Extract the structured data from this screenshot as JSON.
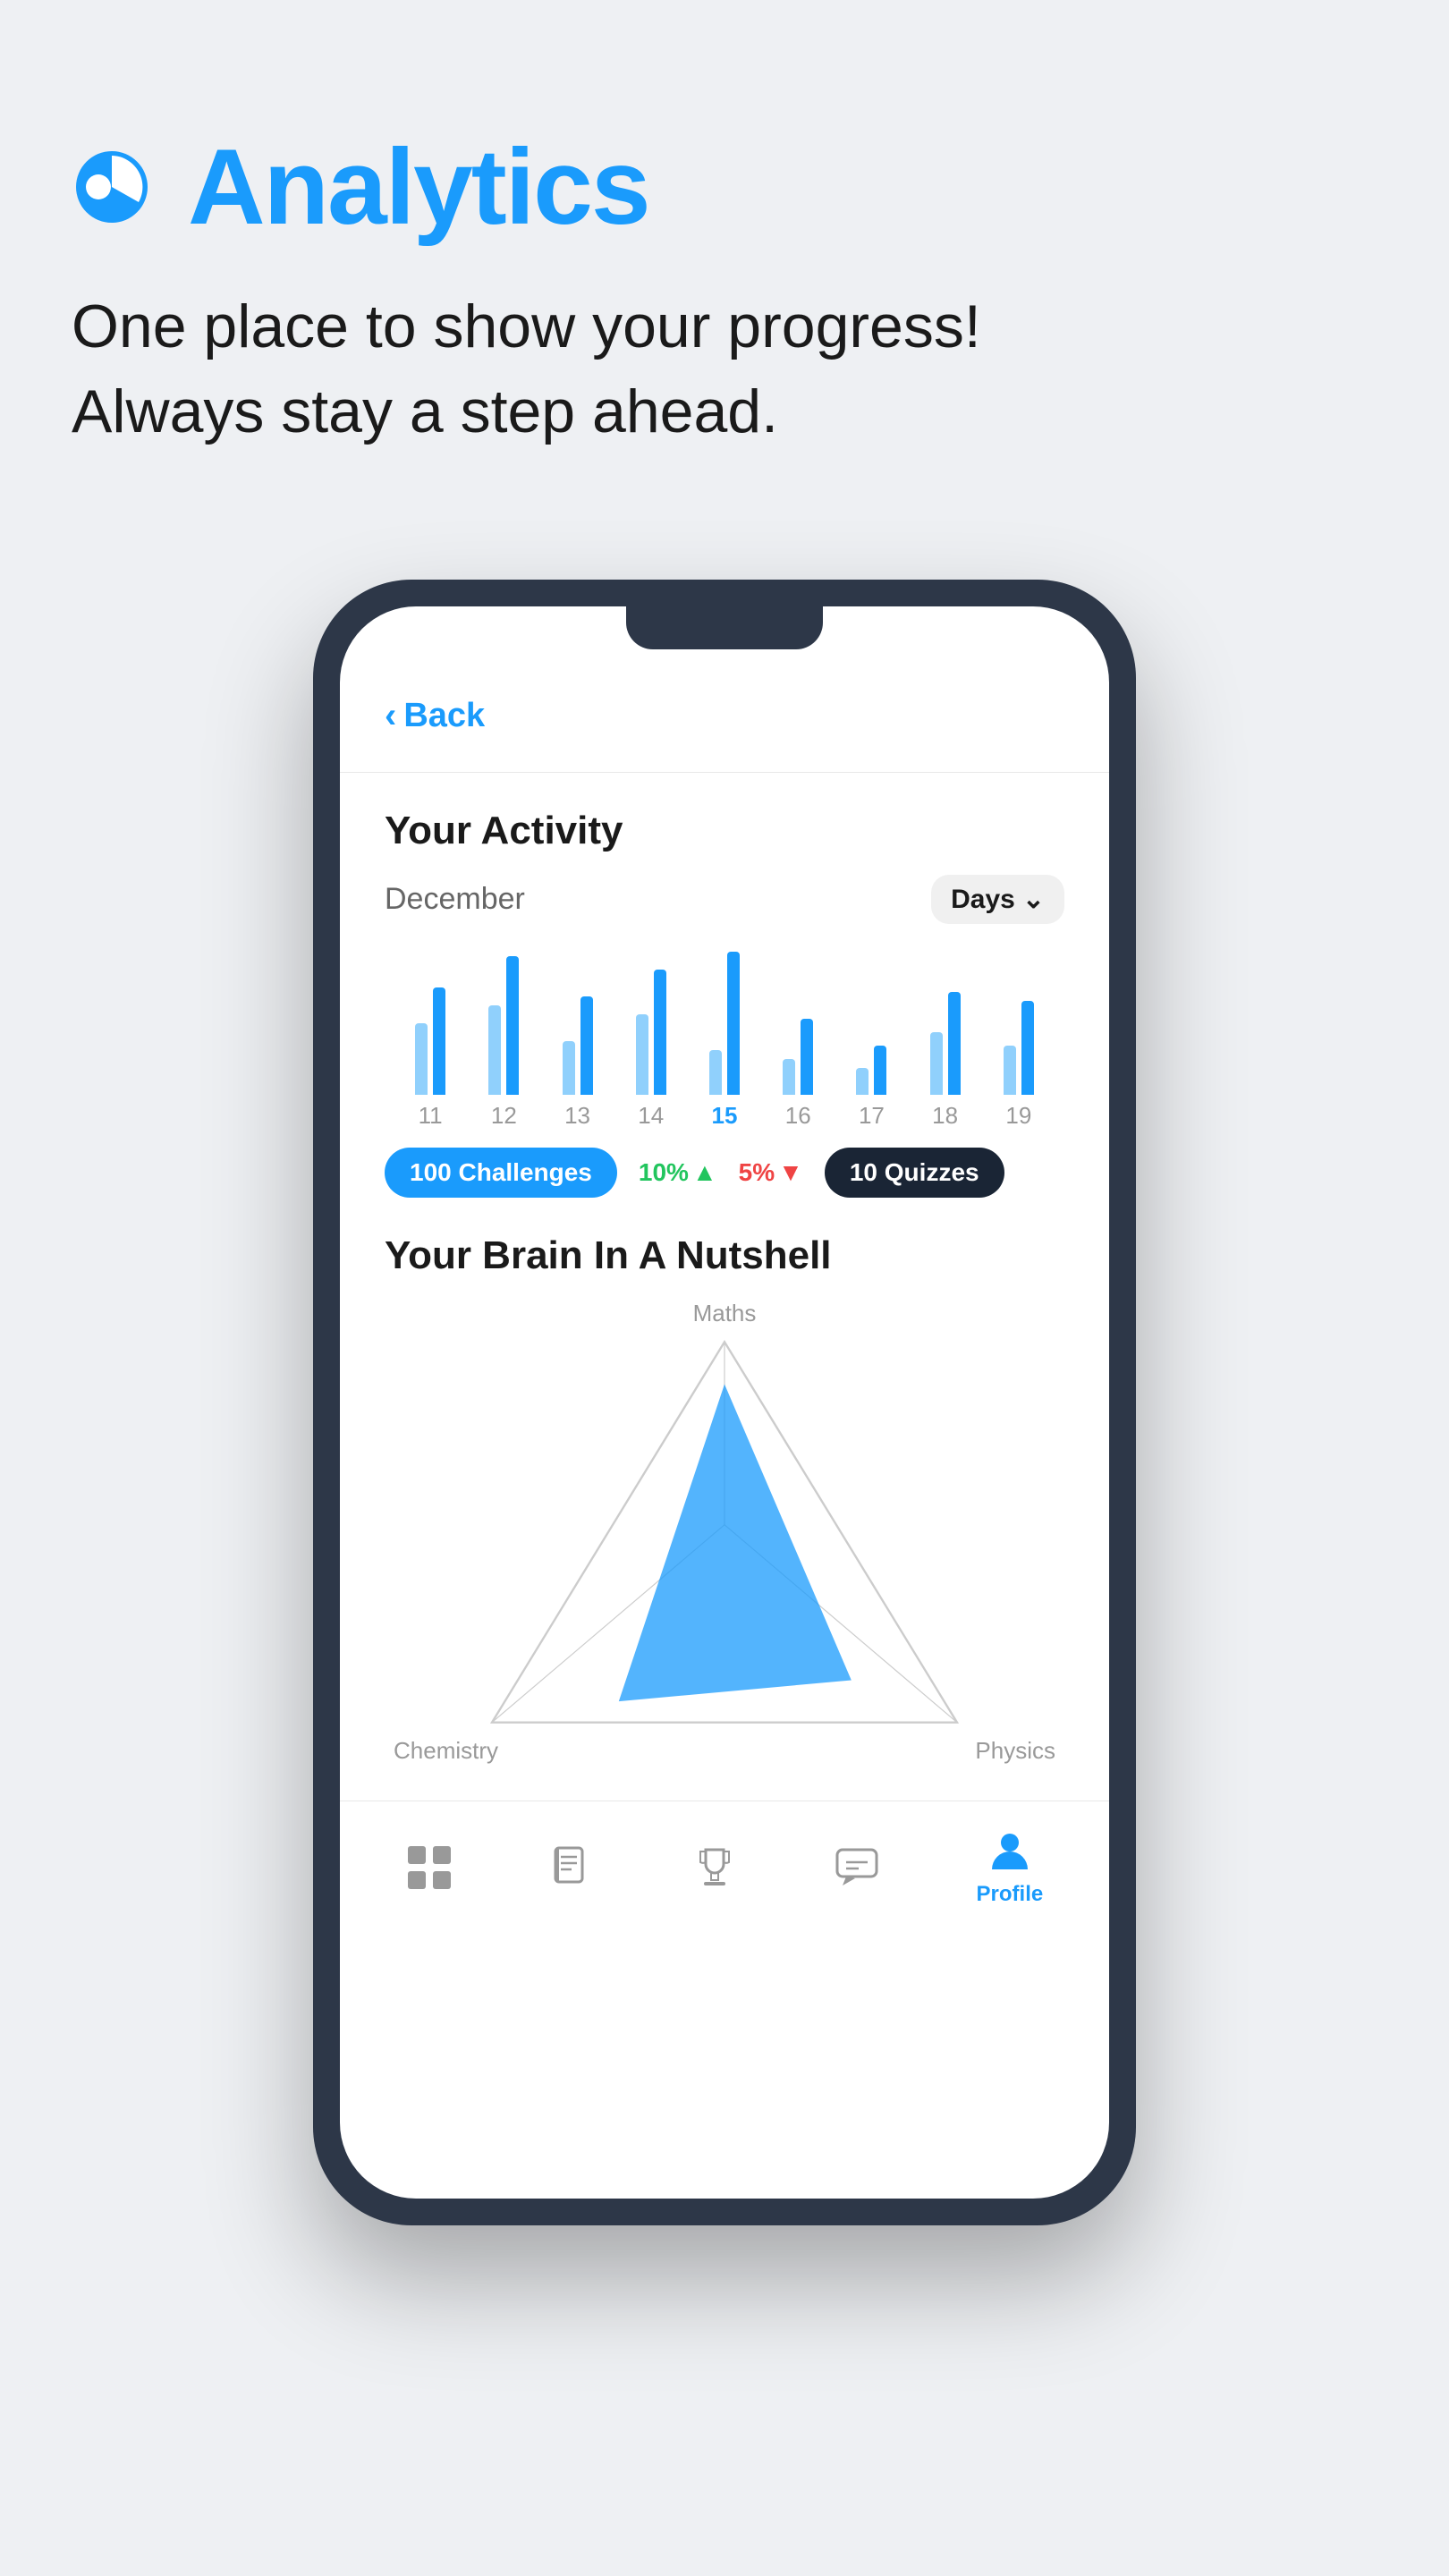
{
  "header": {
    "icon_label": "analytics-pie-icon",
    "title": "Analytics",
    "subtitle_line1": "One place to show your progress!",
    "subtitle_line2": "Always stay a step ahead."
  },
  "phone": {
    "back_label": "Back",
    "screen": {
      "activity_section": {
        "title": "Your Activity",
        "month": "December",
        "period_selector": "Days",
        "bar_labels": [
          "11",
          "12",
          "13",
          "14",
          "15",
          "16",
          "17",
          "18",
          "19"
        ],
        "stats": {
          "challenges_count": "100",
          "challenges_label": "Challenges",
          "change_up": "10%",
          "change_down": "5%",
          "quizzes_count": "10",
          "quizzes_label": "Quizzes"
        }
      },
      "brain_section": {
        "title": "Your Brain In A Nutshell",
        "labels": {
          "top": "Maths",
          "bottom_left": "Chemistry",
          "bottom_right": "Physics"
        }
      },
      "nav": {
        "items": [
          {
            "icon": "grid-icon",
            "label": "",
            "active": false
          },
          {
            "icon": "book-icon",
            "label": "",
            "active": false
          },
          {
            "icon": "trophy-icon",
            "label": "",
            "active": false
          },
          {
            "icon": "chat-icon",
            "label": "",
            "active": false
          },
          {
            "icon": "profile-icon",
            "label": "Profile",
            "active": true
          }
        ]
      }
    }
  }
}
